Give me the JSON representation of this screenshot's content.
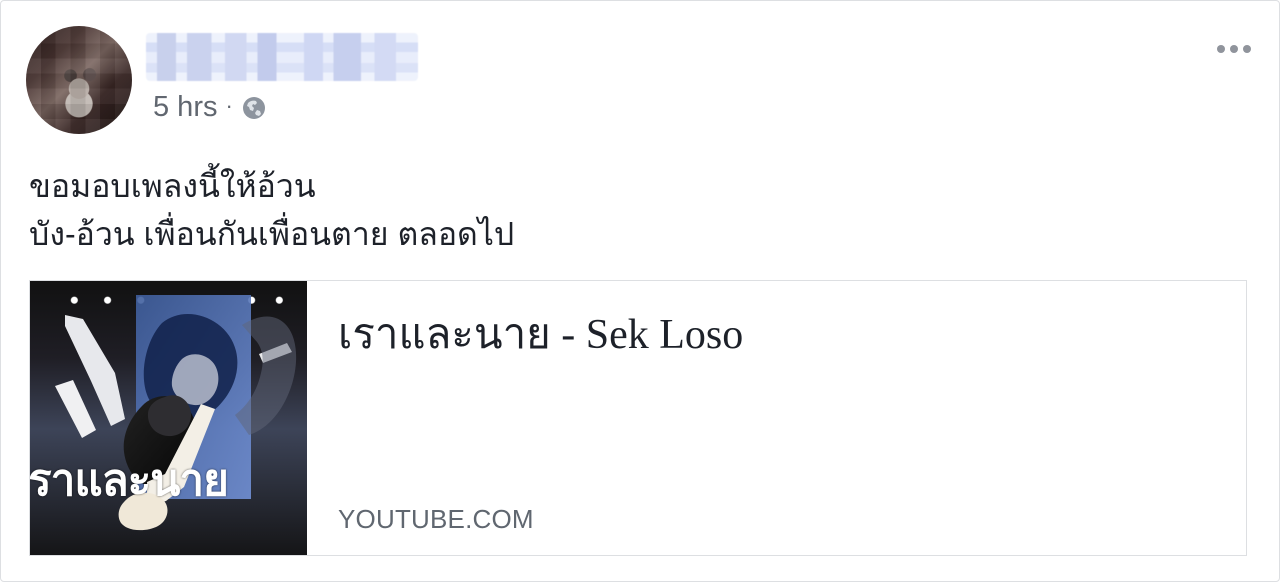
{
  "post": {
    "timestamp": "5 hrs",
    "separator": "·",
    "privacy_icon": "globe-icon",
    "message_lines": [
      "ขอมอบเพลงนี้ให้อ้วน",
      "บัง-อ้วน เพื่อนกันเพื่อนตาย ตลอดไป"
    ]
  },
  "link_preview": {
    "title": "เราและนาย - Sek Loso",
    "domain": "YOUTUBE.COM",
    "thumbnail_caption": "ราและนาย"
  },
  "icons": {
    "more": "more-options-icon",
    "globe": "globe-icon",
    "avatar": "avatar"
  },
  "colors": {
    "text": "#1d2129",
    "secondary_text": "#616770",
    "border": "#dddfe2"
  }
}
